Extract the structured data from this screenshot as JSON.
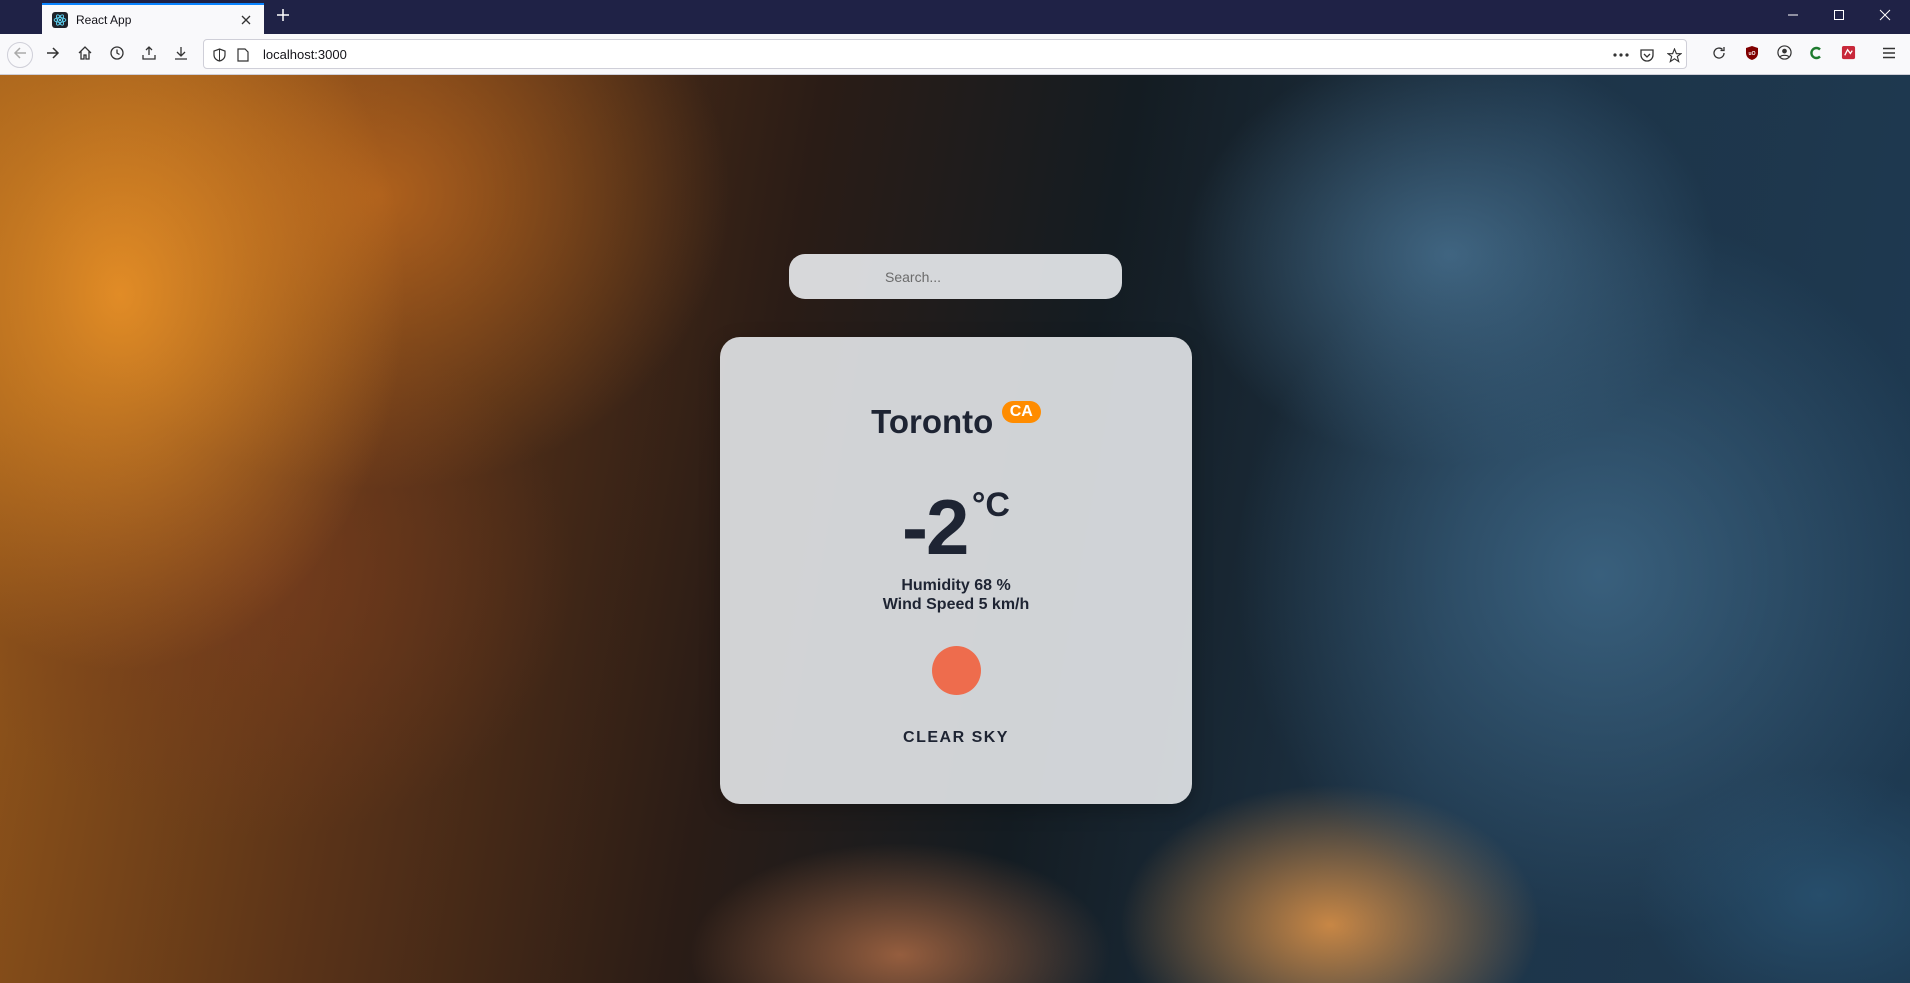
{
  "browser": {
    "tab_title": "React App",
    "url": "localhost:3000",
    "icons": {
      "tab_favicon": "react-icon",
      "tab_close": "close-icon",
      "new_tab": "plus-icon",
      "back": "arrow-left-icon",
      "forward": "arrow-right-icon",
      "home": "home-icon",
      "history": "clock-icon",
      "library": "library-icon",
      "downloads": "download-icon",
      "tracking": "shield-icon",
      "page_info": "page-icon",
      "more": "ellipsis-icon",
      "pocket": "pocket-icon",
      "bookmark": "star-icon",
      "reload": "reload-icon",
      "ublock": "ublock-icon",
      "account": "account-icon",
      "extension_c": "extension-c-icon",
      "extension_red": "extension-icon",
      "menu": "hamburger-menu-icon",
      "minimize": "minimize-icon",
      "maximize": "maximize-icon",
      "close_window": "close-window-icon"
    }
  },
  "app": {
    "search": {
      "value": "",
      "placeholder": "Search..."
    },
    "city": "Toronto",
    "country": "CA",
    "temperature": "-2",
    "unit": "°C",
    "humidity": "Humidity 68 %",
    "wind": "Wind Speed 5 km/h",
    "description": "CLEAR SKY",
    "icon_color": "#ee6c4d",
    "badge_color": "#ff8c00",
    "weather_icon": "sun-icon"
  }
}
